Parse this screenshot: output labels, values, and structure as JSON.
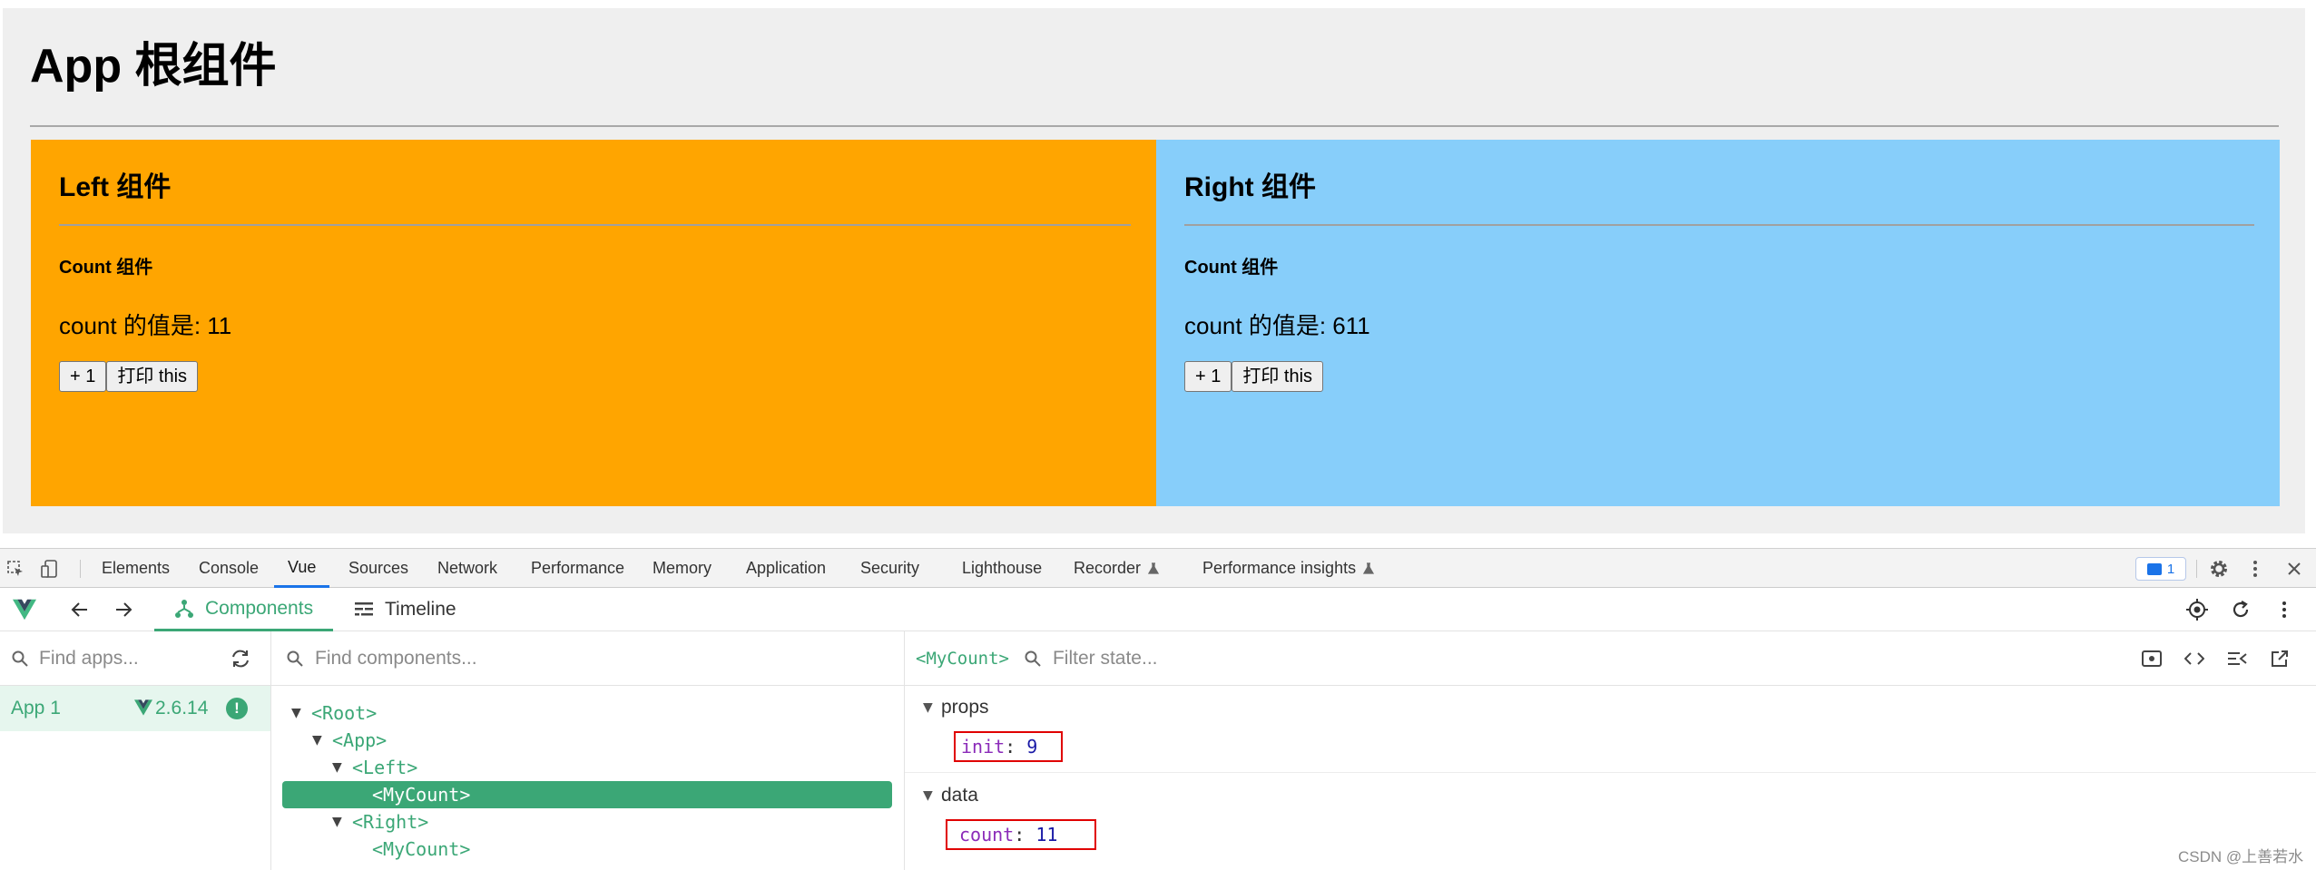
{
  "page": {
    "title": "App 根组件",
    "left_panel": {
      "title": "Left 组件",
      "count_title": "Count 组件",
      "count_text": "count 的值是: 11",
      "plus_button": "+ 1",
      "print_button": "打印 this"
    },
    "right_panel": {
      "title": "Right 组件",
      "count_title": "Count 组件",
      "count_text": "count 的值是: 611",
      "plus_button": "+ 1",
      "print_button": "打印 this"
    },
    "colors": {
      "background": "#efefef",
      "left": "#ffa500",
      "right": "#87cefa"
    }
  },
  "devtools": {
    "tabs": [
      {
        "label": "Elements"
      },
      {
        "label": "Console"
      },
      {
        "label": "Vue",
        "active": true
      },
      {
        "label": "Sources"
      },
      {
        "label": "Network"
      },
      {
        "label": "Performance"
      },
      {
        "label": "Memory"
      },
      {
        "label": "Application"
      },
      {
        "label": "Security"
      },
      {
        "label": "Lighthouse"
      },
      {
        "label": "Recorder"
      },
      {
        "label": "Performance insights"
      }
    ],
    "issues_count": "1",
    "icons": [
      "inspect-icon",
      "device-toggle-icon",
      "flask-icon",
      "gear-icon",
      "kebab-menu-icon",
      "close-icon"
    ]
  },
  "vue": {
    "toolbar": {
      "components_label": "Components",
      "timeline_label": "Timeline",
      "accent": "#3ba776"
    },
    "apps": {
      "search_placeholder": "Find apps...",
      "app_label": "App 1",
      "version": "2.6.14",
      "warning": "!"
    },
    "tree": {
      "search_placeholder": "Find components...",
      "nodes": [
        {
          "label": "<Root>",
          "expanded": true
        },
        {
          "label": "<App>",
          "expanded": true
        },
        {
          "label": "<Left>",
          "expanded": true
        },
        {
          "label": "<MyCount>",
          "selected": true
        },
        {
          "label": "<Right>",
          "expanded": true
        },
        {
          "label": "<MyCount>"
        }
      ]
    },
    "state": {
      "component_name": "<MyCount>",
      "filter_placeholder": "Filter state...",
      "props_label": "props",
      "props": [
        {
          "key": "init",
          "value": "9"
        }
      ],
      "data_label": "data",
      "data": [
        {
          "key": "count",
          "value": "11"
        }
      ]
    }
  },
  "watermark": "CSDN @上善若水"
}
